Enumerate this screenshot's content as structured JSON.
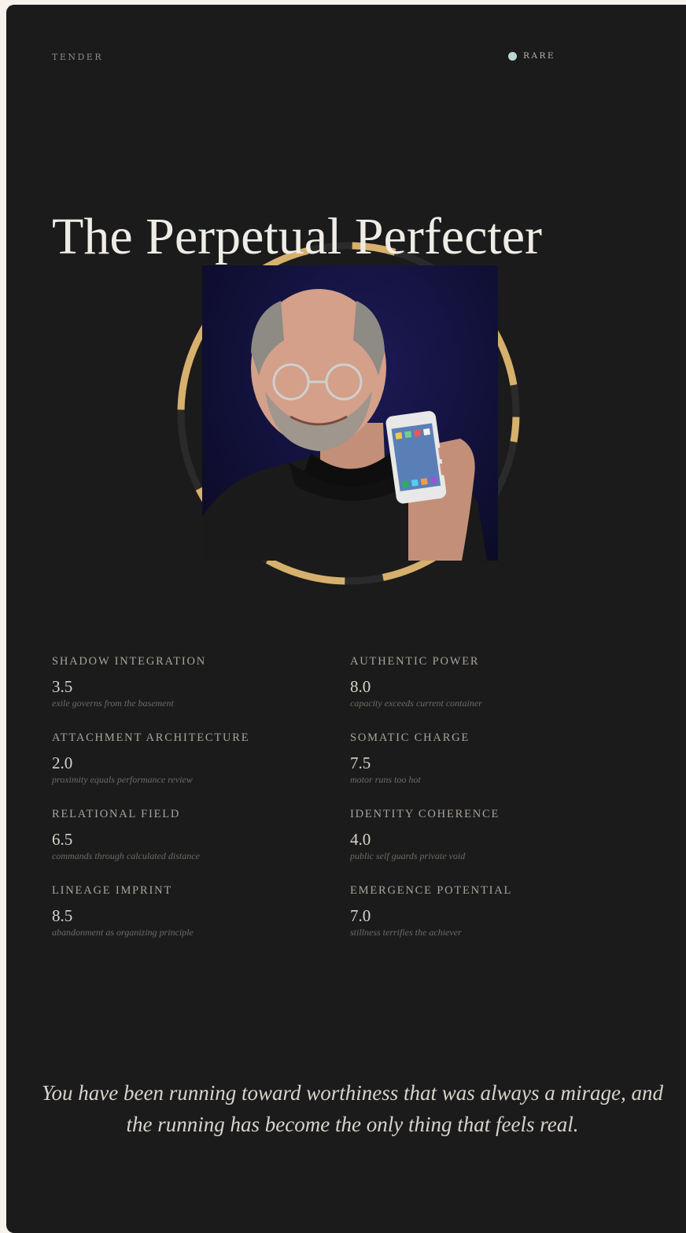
{
  "header": {
    "brand": "TENDER",
    "rarity": "RARE",
    "rarity_dot_color": "#b7d6d6"
  },
  "profile": {
    "title": "The Perpetual Perfecter",
    "ring_accent_color": "#d6b06d",
    "ring_track_color": "#2a2a2a"
  },
  "metrics": [
    {
      "label": "SHADOW INTEGRATION",
      "score": "3.5",
      "note": "exile governs from the basement"
    },
    {
      "label": "AUTHENTIC POWER",
      "score": "8.0",
      "note": "capacity exceeds current container"
    },
    {
      "label": "ATTACHMENT ARCHITECTURE",
      "score": "2.0",
      "note": "proximity equals performance review"
    },
    {
      "label": "SOMATIC CHARGE",
      "score": "7.5",
      "note": "motor runs too hot"
    },
    {
      "label": "RELATIONAL FIELD",
      "score": "6.5",
      "note": "commands through calculated distance"
    },
    {
      "label": "IDENTITY COHERENCE",
      "score": "4.0",
      "note": "public self guards private void"
    },
    {
      "label": "LINEAGE IMPRINT",
      "score": "8.5",
      "note": "abandonment as organizing principle"
    },
    {
      "label": "EMERGENCE POTENTIAL",
      "score": "7.0",
      "note": "stillness terrifies the achiever"
    }
  ],
  "quote": "You have been running toward worthiness that was always a mirage, and the running has become the only thing that feels real."
}
